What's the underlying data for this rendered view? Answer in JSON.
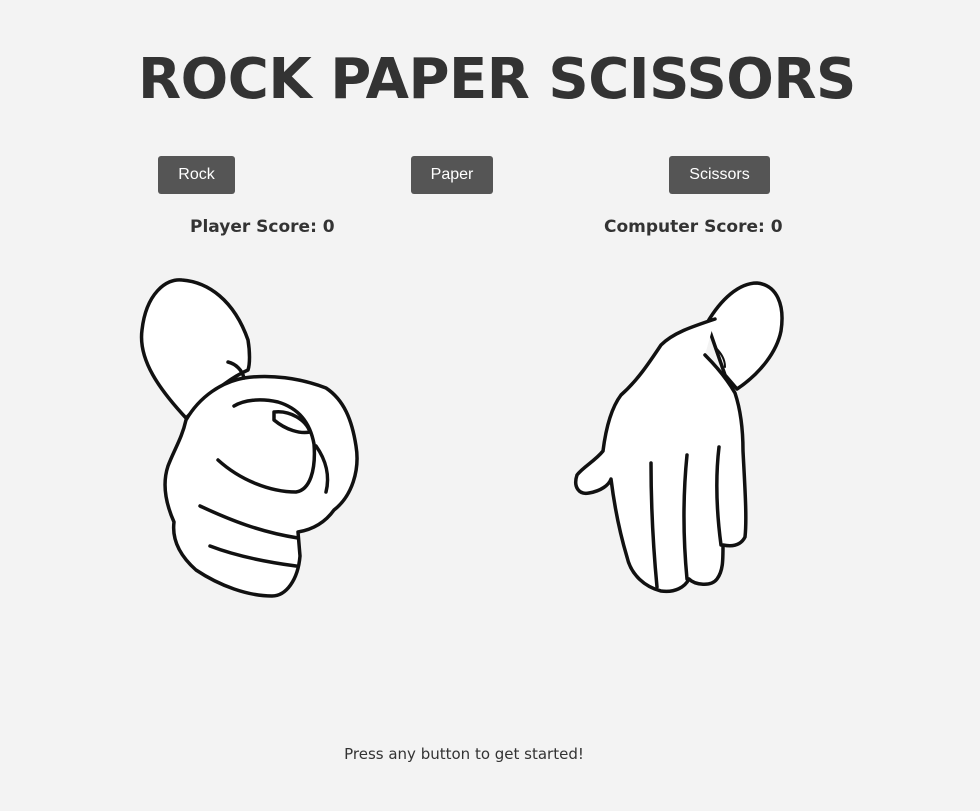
{
  "title": "ROCK PAPER SCISSORS",
  "buttons": {
    "rock": "Rock",
    "paper": "Paper",
    "scissors": "Scissors"
  },
  "scores": {
    "player_label": "Player Score: 0",
    "computer_label": "Computer Score: 0"
  },
  "hands": {
    "player": "fist-rock-icon",
    "computer": "open-hand-paper-icon"
  },
  "status_message": "Press any button to get started!",
  "colors": {
    "background": "#f3f3f3",
    "button": "#555555",
    "button_text": "#ffffff",
    "text": "#333333"
  }
}
